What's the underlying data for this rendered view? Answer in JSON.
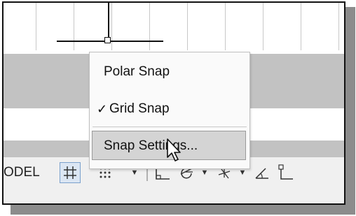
{
  "snap_menu": {
    "polar_snap": "Polar Snap",
    "grid_snap": "Grid Snap",
    "grid_snap_check": "✓",
    "snap_settings": "Snap Settings..."
  },
  "status_bar": {
    "model_label": "ODEL",
    "dropdown_glyph": "▼",
    "grid_active": true
  },
  "colors": {
    "status_band": "#c2c2c2",
    "menu_highlight": "#d4d4d4",
    "button_active": "#dbe6f3"
  }
}
